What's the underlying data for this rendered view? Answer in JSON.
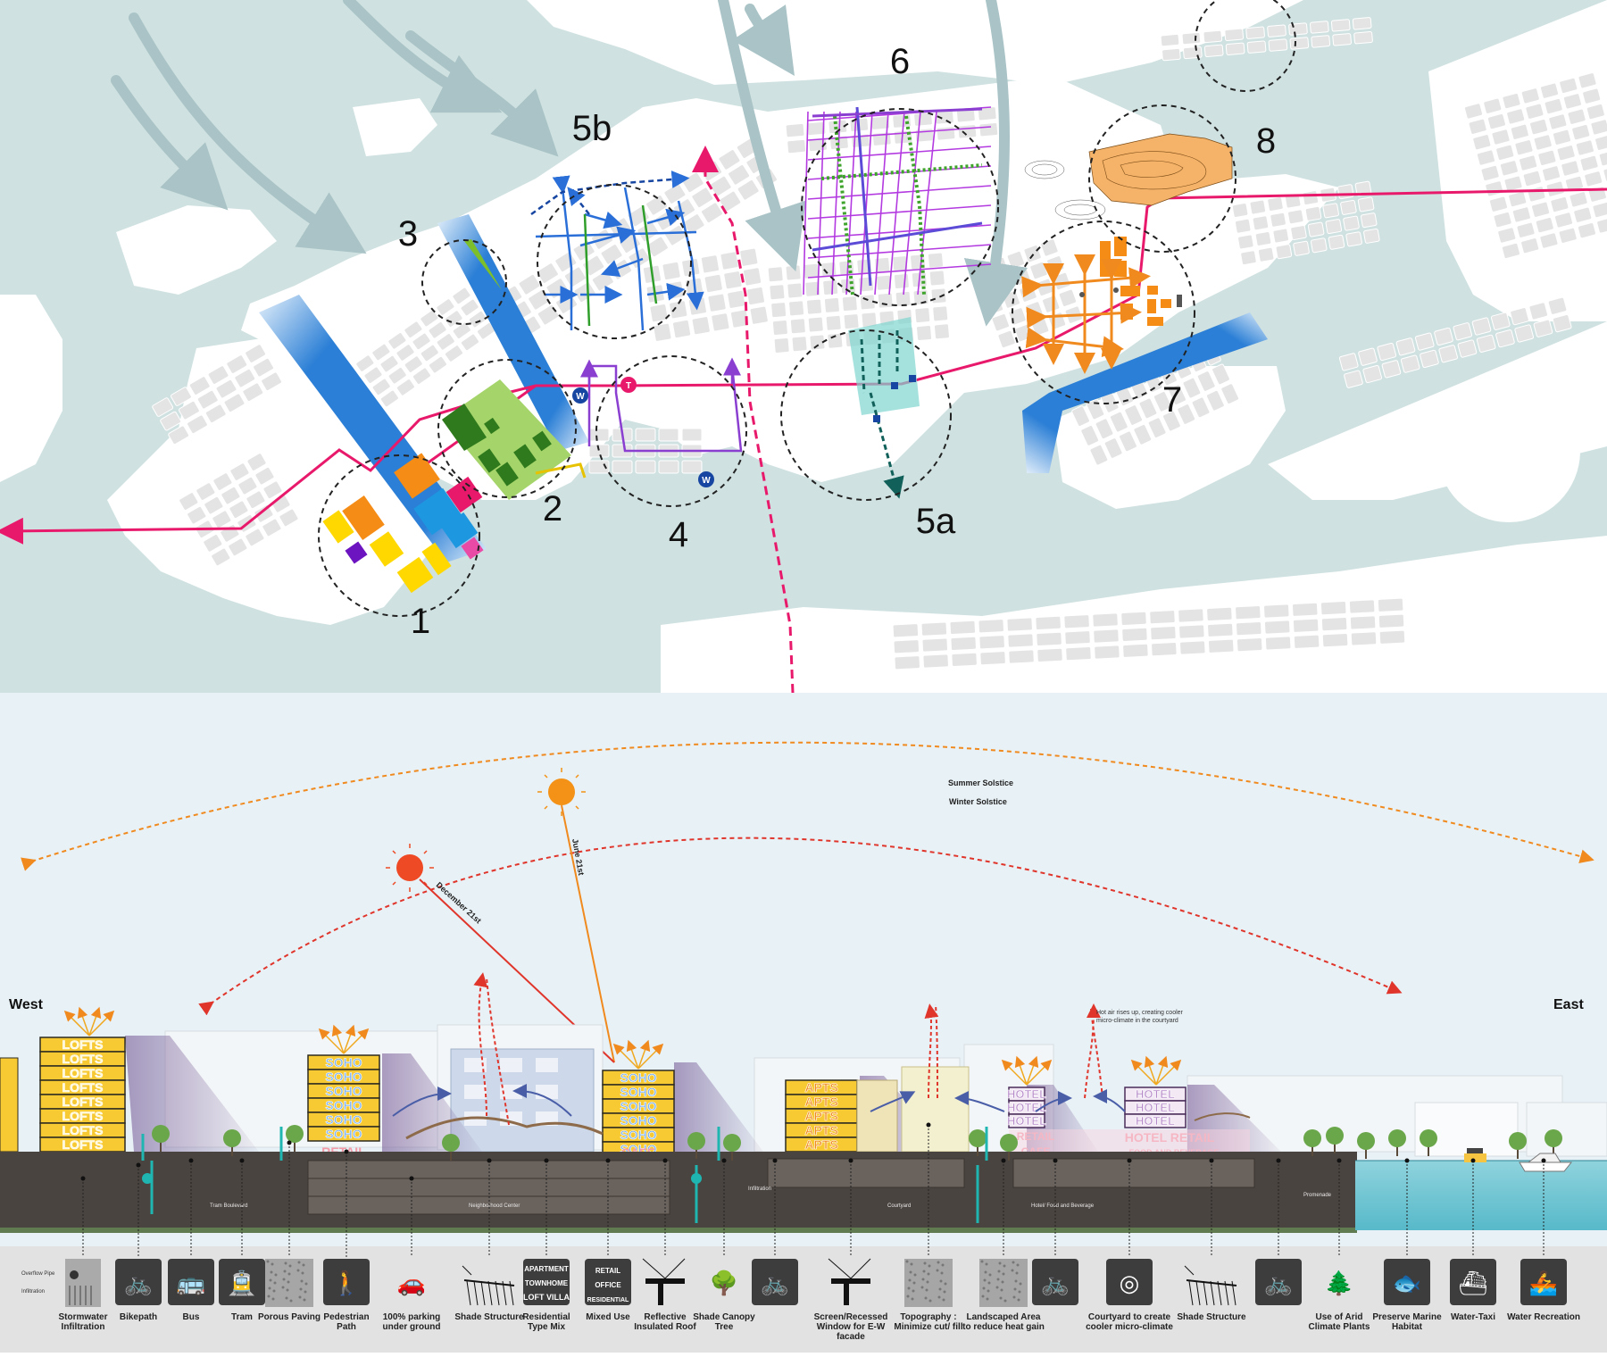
{
  "map": {
    "zone_labels": [
      "1",
      "2",
      "3",
      "4",
      "5a",
      "5b",
      "6",
      "7",
      "8"
    ],
    "transit_badges": {
      "w": "W",
      "t": "T"
    }
  },
  "section": {
    "solstice": {
      "summer": "Summer Solstice",
      "winter": "Winter Solstice",
      "june": "June 21st",
      "december": "December 21st"
    },
    "directions": {
      "west": "West",
      "east": "East"
    },
    "hot_air_note": [
      "Hot air rises up, creating cooler",
      "micro-climate in the courtyard"
    ],
    "ground_labels": [
      "Tram Boulevard",
      "Neighborhood Center",
      "Infiltration",
      "Courtyard",
      "Hotel/ Food and Beverage",
      "Promenade"
    ],
    "stormwater_notes": [
      "Overflow Pipe",
      "Infiltration"
    ],
    "buildings": {
      "lofts": "LOFTS",
      "soho": "SOHO",
      "retail": "RETAIL",
      "cafe": "CAFE",
      "apts": "APTS",
      "hotel": "HOTEL",
      "hotel_retail": "HOTEL RETAIL",
      "food_beverage": "FOOD AND BEVERAGE"
    }
  },
  "legend": [
    {
      "label": "Stormwater|Infiltration",
      "icon": "stormwater-icon"
    },
    {
      "label": "Bikepath",
      "icon": "bicycle-icon"
    },
    {
      "label": "Bus",
      "icon": "bus-icon"
    },
    {
      "label": "Tram",
      "icon": "tram-icon"
    },
    {
      "label": "Porous Paving",
      "icon": "porous-paving-icon"
    },
    {
      "label": "Pedestrian|Path",
      "icon": "pedestrian-icon"
    },
    {
      "label": "100% parking|under ground",
      "icon": "car-icon"
    },
    {
      "label": "Shade Structure",
      "icon": "shade-structure-icon"
    },
    {
      "label": "Residential|Type Mix",
      "icon": "residential-mix-icon"
    },
    {
      "label": "Mixed Use",
      "icon": "mixed-use-icon"
    },
    {
      "label": "Reflective|Insulated Roof",
      "icon": "reflective-roof-icon"
    },
    {
      "label": "Shade Canopy|Tree",
      "icon": "canopy-tree-icon"
    },
    {
      "label": "",
      "icon": "bike-walk-tree-icon"
    },
    {
      "label": "Screen/Recessed|Window for E-W|facade",
      "icon": "window-screen-icon"
    },
    {
      "label": "Topography :|Minimize cut/ fill",
      "icon": "topography-icon"
    },
    {
      "label": "Landscaped Area|to reduce heat gain",
      "icon": "landscape-icon"
    },
    {
      "label": "",
      "icon": "bike-walk-tree-icon"
    },
    {
      "label": "Courtyard to create|cooler micro-climate",
      "icon": "courtyard-icon"
    },
    {
      "label": "Shade Structure",
      "icon": "shade-structure-icon"
    },
    {
      "label": "",
      "icon": "bike-walk-tree-icon"
    },
    {
      "label": "Use of  Arid|Climate Plants",
      "icon": "arid-plants-icon"
    },
    {
      "label": "Preserve Marine|Habitat",
      "icon": "fish-icon"
    },
    {
      "label": "Water-Taxi",
      "icon": "water-taxi-icon"
    },
    {
      "label": "Water Recreation",
      "icon": "kayak-icon"
    }
  ],
  "legend_icon_words": [
    "APARTMENT",
    "TOWNHOME",
    "LOFT",
    "VILLA",
    "RETAIL",
    "OFFICE",
    "RESIDENTIAL"
  ],
  "colors": {
    "water": "#cfe1e0",
    "land": "#ffffff",
    "block": "#e4e4e4",
    "route": "#e8196b",
    "canal": "#2b7fd6",
    "sky": "#e8f1f6",
    "ground": "#4a4440",
    "legend_bg": "#e2e2e2"
  }
}
